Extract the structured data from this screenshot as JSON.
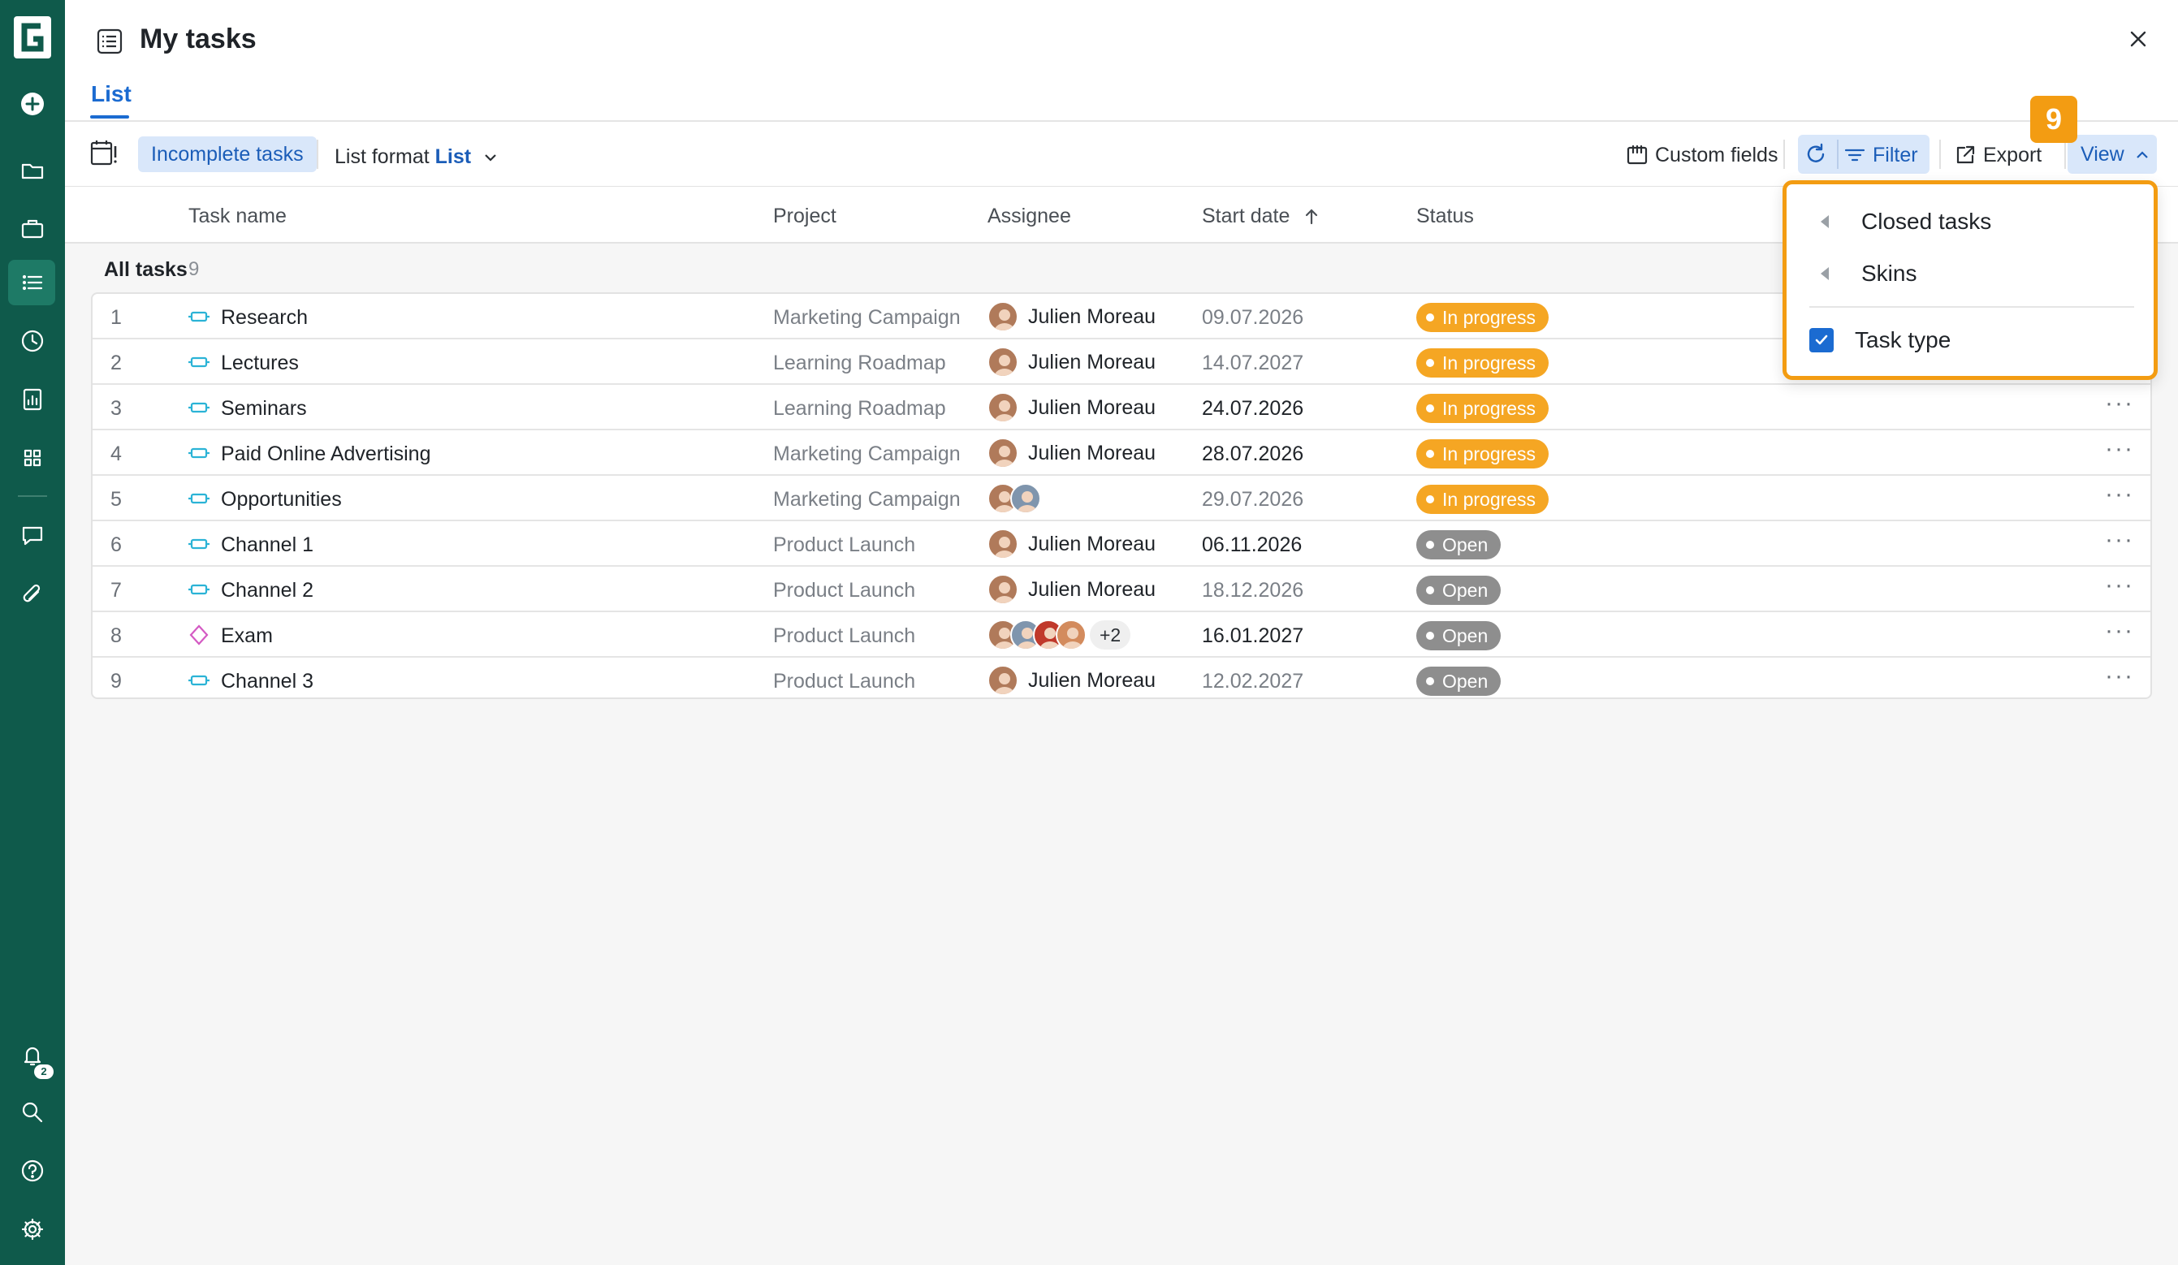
{
  "app": {
    "title": "My tasks",
    "close_label": "×"
  },
  "sidebar": {
    "notification_badge": "2",
    "items": [
      {
        "icon": "plus-circle-icon"
      },
      {
        "icon": "folder-icon"
      },
      {
        "icon": "briefcase-icon"
      },
      {
        "icon": "list-icon"
      },
      {
        "icon": "clock-icon"
      },
      {
        "icon": "report-icon"
      },
      {
        "icon": "grid-icon"
      },
      {
        "icon": "chat-icon"
      },
      {
        "icon": "paperclip-icon"
      },
      {
        "icon": "bell-icon"
      },
      {
        "icon": "search-icon"
      },
      {
        "icon": "help-icon"
      },
      {
        "icon": "gear-icon"
      }
    ]
  },
  "tabs": {
    "list": "List"
  },
  "toolbar": {
    "incomplete_tasks": "Incomplete tasks",
    "list_format_prefix": "List format",
    "list_format_value": "List",
    "custom_fields": "Custom fields",
    "filter": "Filter",
    "export": "Export",
    "view": "View"
  },
  "step_badge": "9",
  "table": {
    "columns": {
      "task_name": "Task name",
      "project": "Project",
      "assignee": "Assignee",
      "start_date": "Start date",
      "status": "Status"
    },
    "group": {
      "label": "All tasks",
      "count": "9"
    },
    "rows": [
      {
        "num": "1",
        "name": "Research",
        "type": "task",
        "project": "Marketing Campaign",
        "assignee": "Julien Moreau",
        "date": "09.07.2026",
        "date_dim": true,
        "status": "In progress"
      },
      {
        "num": "2",
        "name": "Lectures",
        "type": "task",
        "project": "Learning Roadmap",
        "assignee": "Julien Moreau",
        "date": "14.07.2027",
        "date_dim": true,
        "status": "In progress"
      },
      {
        "num": "3",
        "name": "Seminars",
        "type": "task",
        "project": "Learning Roadmap",
        "assignee": "Julien Moreau",
        "date": "24.07.2026",
        "date_dim": false,
        "status": "In progress"
      },
      {
        "num": "4",
        "name": "Paid Online Advertising",
        "type": "task",
        "project": "Marketing Campaign",
        "assignee": "Julien Moreau",
        "date": "28.07.2026",
        "date_dim": false,
        "status": "In progress"
      },
      {
        "num": "5",
        "name": "Opportunities",
        "type": "task",
        "project": "Marketing Campaign",
        "assignee": "",
        "avatars": 2,
        "date": "29.07.2026",
        "date_dim": true,
        "status": "In progress"
      },
      {
        "num": "6",
        "name": "Channel 1",
        "type": "task",
        "project": "Product Launch",
        "assignee": "Julien Moreau",
        "date": "06.11.2026",
        "date_dim": false,
        "status": "Open"
      },
      {
        "num": "7",
        "name": "Channel 2",
        "type": "task",
        "project": "Product Launch",
        "assignee": "Julien Moreau",
        "date": "18.12.2026",
        "date_dim": true,
        "status": "Open"
      },
      {
        "num": "8",
        "name": "Exam",
        "type": "milestone",
        "project": "Product Launch",
        "assignee": "",
        "avatars": 4,
        "more": "+2",
        "date": "16.01.2027",
        "date_dim": false,
        "status": "Open"
      },
      {
        "num": "9",
        "name": "Channel 3",
        "type": "task",
        "project": "Product Launch",
        "assignee": "Julien Moreau",
        "date": "12.02.2027",
        "date_dim": true,
        "status": "Open"
      }
    ],
    "more_label": "···"
  },
  "view_menu": {
    "closed_tasks": "Closed tasks",
    "skins": "Skins",
    "task_type": "Task type",
    "task_type_checked": true
  },
  "colors": {
    "sidebar": "#0f5a4b",
    "accent": "#1b6bd1",
    "in_progress": "#f5a623",
    "open": "#8e8e8e",
    "highlight": "#f39c12"
  }
}
